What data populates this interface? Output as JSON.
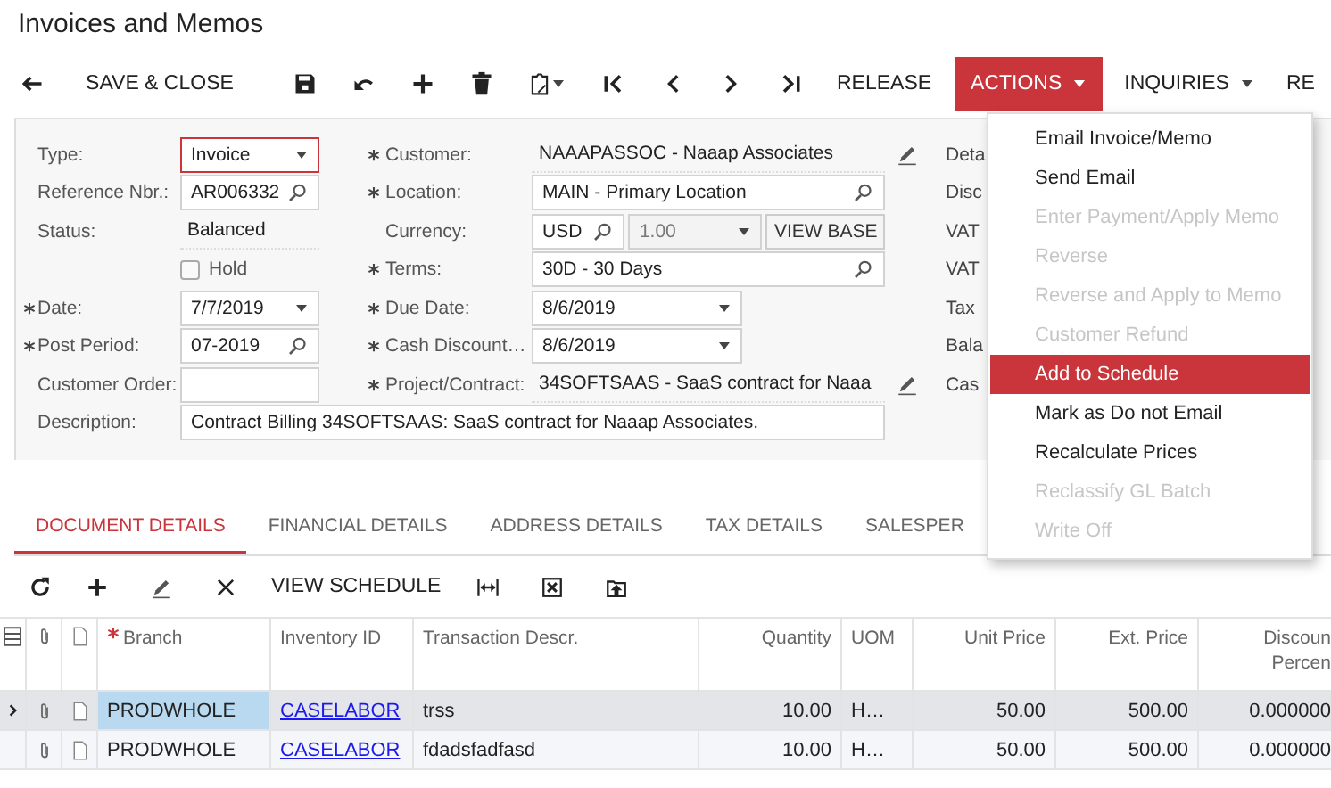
{
  "title": "Invoices and Memos",
  "toolbar": {
    "save_close": "SAVE & CLOSE",
    "release": "RELEASE",
    "actions": {
      "label": "ACTIONS",
      "open": true
    },
    "inquiries": "INQUIRIES",
    "cut_button": "RE"
  },
  "actions_menu": {
    "items": [
      {
        "label": "Email Invoice/Memo",
        "disabled": false,
        "selected": false
      },
      {
        "label": "Send Email",
        "disabled": false,
        "selected": false
      },
      {
        "label": "Enter Payment/Apply Memo",
        "disabled": true,
        "selected": false
      },
      {
        "label": "Reverse",
        "disabled": true,
        "selected": false
      },
      {
        "label": "Reverse and Apply to Memo",
        "disabled": true,
        "selected": false
      },
      {
        "label": "Customer Refund",
        "disabled": true,
        "selected": false
      },
      {
        "label": "Add to Schedule",
        "disabled": false,
        "selected": true
      },
      {
        "label": "Mark as Do not Email",
        "disabled": false,
        "selected": false
      },
      {
        "label": "Recalculate Prices",
        "disabled": false,
        "selected": false
      },
      {
        "label": "Reclassify GL Batch",
        "disabled": true,
        "selected": false
      },
      {
        "label": "Write Off",
        "disabled": true,
        "selected": false
      }
    ]
  },
  "form": {
    "left": [
      {
        "label": "Type:",
        "kind": "select",
        "value": "Invoice",
        "focused": true
      },
      {
        "label": "Reference Nbr.:",
        "kind": "lookup",
        "value": "AR006332"
      },
      {
        "label": "Status:",
        "kind": "display",
        "value": "Balanced"
      },
      {
        "label": "Hold",
        "kind": "checkbox",
        "checked": false
      },
      {
        "label": "Date:",
        "required": true,
        "kind": "select",
        "value": "7/7/2019"
      },
      {
        "label": "Post Period:",
        "required": true,
        "kind": "lookup",
        "value": "07-2019"
      },
      {
        "label": "Customer Order:",
        "kind": "text"
      }
    ],
    "middle": [
      {
        "label": "Customer:",
        "required": true,
        "kind": "display",
        "value": "NAAAPASSOC - Naaap Associates",
        "editable": true
      },
      {
        "label": "Location:",
        "required": true,
        "kind": "lookup",
        "value": "MAIN - Primary Location"
      },
      {
        "label": "Currency:",
        "kind": "currency",
        "value": "USD",
        "rate": "1.00",
        "rate_disabled": true,
        "button": "VIEW BASE"
      },
      {
        "label": "Terms:",
        "required": true,
        "kind": "lookup",
        "value": "30D - 30 Days"
      },
      {
        "label": "Due Date:",
        "required": true,
        "kind": "select",
        "value": "8/6/2019"
      },
      {
        "label": "Cash Discount…",
        "required": true,
        "kind": "select",
        "value": "8/6/2019"
      },
      {
        "label": "Project/Contract:",
        "required": true,
        "kind": "display",
        "value": "34SOFTSAAS - SaaS contract for Naaa",
        "editable": true
      }
    ],
    "description": {
      "label": "Description:",
      "value": "Contract Billing 34SOFTSAAS: SaaS contract for Naaap Associates."
    },
    "right": [
      "Deta",
      "Disc",
      "VAT",
      "VAT",
      "Tax",
      "Bala",
      "Cas"
    ]
  },
  "tabs": [
    {
      "label": "DOCUMENT DETAILS",
      "selected": true
    },
    {
      "label": "FINANCIAL DETAILS",
      "selected": false
    },
    {
      "label": "ADDRESS DETAILS",
      "selected": false
    },
    {
      "label": "TAX DETAILS",
      "selected": false
    },
    {
      "label": "SALESPER",
      "selected": false
    }
  ],
  "grid_toolbar": {
    "view_schedule": "VIEW SCHEDULE"
  },
  "table": {
    "columns": [
      {
        "label": "Branch",
        "required": true,
        "kind": "text"
      },
      {
        "label": "Inventory ID",
        "kind": "link"
      },
      {
        "label": "Transaction Descr.",
        "kind": "text"
      },
      {
        "label": "Quantity",
        "kind": "number"
      },
      {
        "label": "UOM",
        "kind": "text"
      },
      {
        "label": "Unit Price",
        "kind": "number"
      },
      {
        "label": "Ext. Price",
        "kind": "number"
      },
      {
        "label": "Discoun Percen",
        "kind": "number"
      }
    ],
    "rows": [
      {
        "selected": true,
        "cells": [
          "PRODWHOLE",
          "CASELABOR",
          "trss",
          "10.00",
          "H…",
          "50.00",
          "500.00",
          "0.000000"
        ]
      },
      {
        "selected": false,
        "cells": [
          "PRODWHOLE",
          "CASELABOR",
          "fdadsfadfasd",
          "10.00",
          "H…",
          "50.00",
          "500.00",
          "0.000000"
        ]
      }
    ]
  }
}
